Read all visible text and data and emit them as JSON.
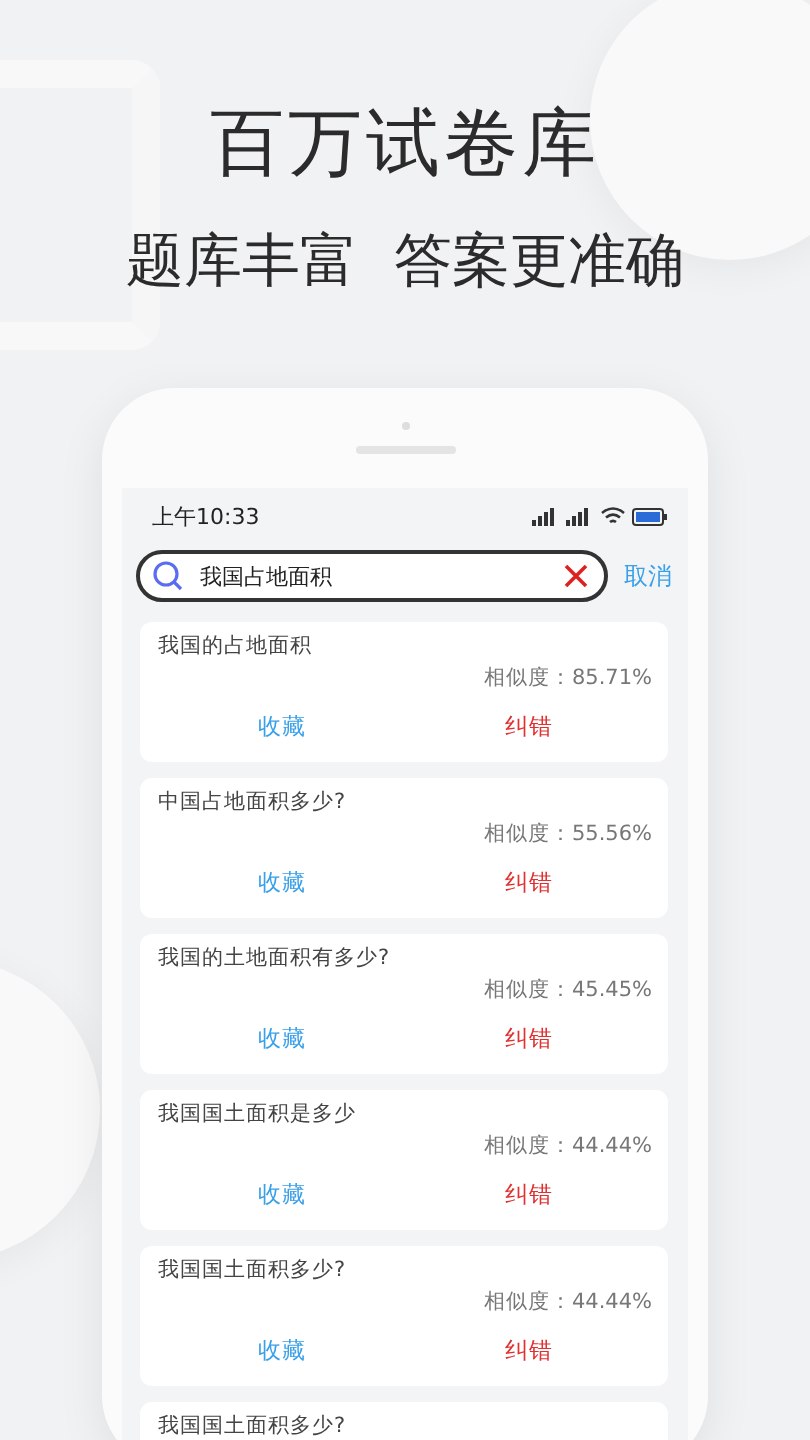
{
  "headline": "百万试卷库",
  "subheadline": "题库丰富  答案更准确",
  "status_bar": {
    "time": "上午10:33"
  },
  "search": {
    "value": "我国占地面积",
    "cancel": "取消"
  },
  "results": [
    {
      "question": "我国的占地面积",
      "similarity": "相似度：85.71%",
      "actions": [
        {
          "kind": "favorite",
          "label": "收藏"
        },
        {
          "kind": "report",
          "label": "纠错"
        }
      ]
    },
    {
      "question": "中国占地面积多少?",
      "similarity": "相似度：55.56%",
      "actions": [
        {
          "kind": "favorite",
          "label": "收藏"
        },
        {
          "kind": "report",
          "label": "纠错"
        }
      ]
    },
    {
      "question": "我国的土地面积有多少?",
      "similarity": "相似度：45.45%",
      "actions": [
        {
          "kind": "favorite",
          "label": "收藏"
        },
        {
          "kind": "report",
          "label": "纠错"
        }
      ]
    },
    {
      "question": "我国国土面积是多少",
      "similarity": "相似度：44.44%",
      "actions": [
        {
          "kind": "favorite",
          "label": "收藏"
        },
        {
          "kind": "report",
          "label": "纠错"
        }
      ]
    },
    {
      "question": "我国国土面积多少?",
      "similarity": "相似度：44.44%",
      "actions": [
        {
          "kind": "favorite",
          "label": "收藏"
        },
        {
          "kind": "report",
          "label": "纠错"
        }
      ]
    },
    {
      "question": "我国国土面积多少?"
    }
  ]
}
